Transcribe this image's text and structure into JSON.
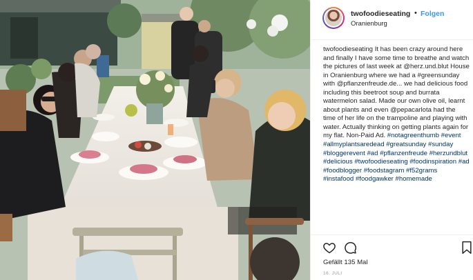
{
  "photo": {
    "alt_subject": "garden-dinner-party-photo"
  },
  "post": {
    "username": "twofoodieseating",
    "separator": "•",
    "follow_label": "Folgen",
    "location": "Oranienburg",
    "caption_user": "twofoodieseating",
    "caption_text": "It has been crazy around here and finally I have some time to breathe and watch the pictures of last week at @herz.und.blut House in Oranienburg where we had a #greensunday with @pflanzenfreude.de... we had delicious food including this beetroot soup and burrata watermelon salad. Made our own olive oil, learnt about plants and even @pepacarlota had the time of her life on the trampoline and playing with water. Actually thinking on getting plants again for my flat. Non-Paid Ad.",
    "hashtags": "#notagreenthumb #event #allmyplantsaredead #greatsunday #sunday #bloggerevent #ad #pflanzenfreude #herzundblut #delicious #twofoodieseating #foodinspiration #ad #foodblogger #foodstagram #f52grams #instafood #foodgawker #homemade",
    "likes": "Gefällt 135 Mal",
    "date": "16. JULI"
  },
  "icons": {
    "like": "heart-icon",
    "comment": "comment-icon",
    "save": "bookmark-icon"
  },
  "colors": {
    "link": "#3897f0",
    "text": "#262626",
    "muted": "#999999",
    "border": "#efefef"
  }
}
